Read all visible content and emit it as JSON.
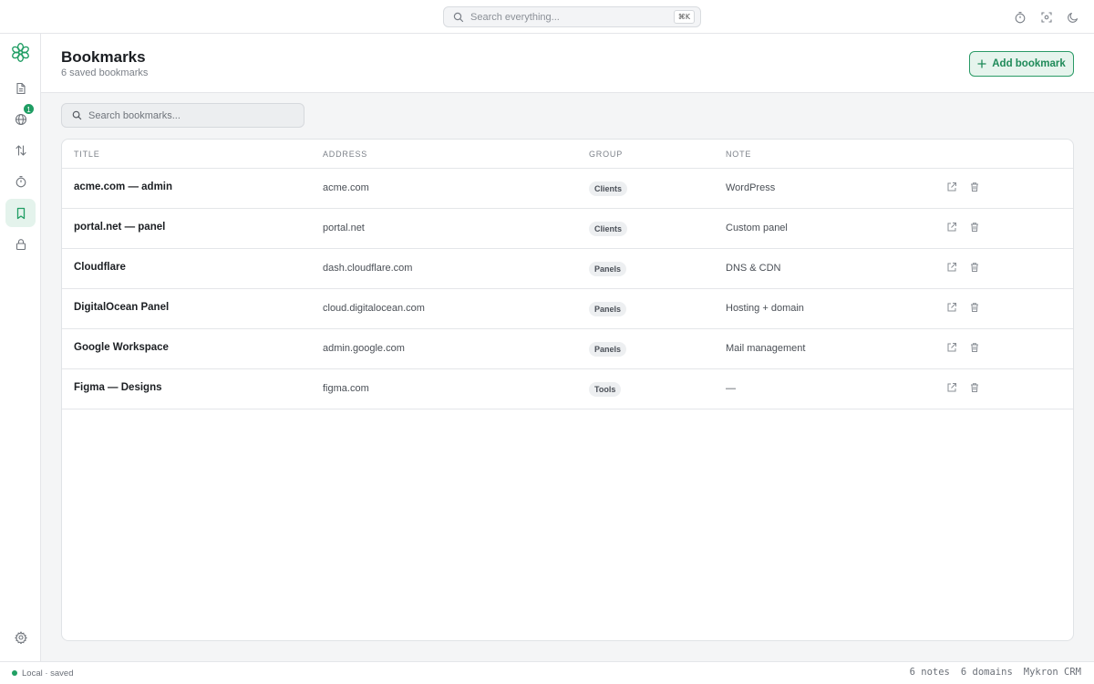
{
  "topbar": {
    "search_placeholder": "Search everything...",
    "search_shortcut": "⌘K",
    "actions": [
      "timer-icon",
      "scan-icon",
      "moon-icon"
    ]
  },
  "sidebar": {
    "logo": "flower-logo-icon",
    "items": [
      {
        "icon": "document-icon",
        "active": false
      },
      {
        "icon": "globe-icon",
        "active": false,
        "badge": "1"
      },
      {
        "icon": "transfer-arrows-icon",
        "active": false
      },
      {
        "icon": "stopwatch-icon",
        "active": false
      },
      {
        "icon": "bookmark-icon",
        "active": true
      },
      {
        "icon": "lock-icon",
        "active": false
      }
    ],
    "settings_icon": "gear-icon"
  },
  "header": {
    "title": "Bookmarks",
    "subtitle": "6 saved bookmarks",
    "add_button": "Add bookmark"
  },
  "search": {
    "placeholder": "Search bookmarks..."
  },
  "table": {
    "columns": [
      "TITLE",
      "ADDRESS",
      "GROUP",
      "NOTE"
    ],
    "rows": [
      {
        "title": "acme.com — admin",
        "address": "acme.com",
        "group": "Clients",
        "note": "WordPress"
      },
      {
        "title": "portal.net — panel",
        "address": "portal.net",
        "group": "Clients",
        "note": "Custom panel"
      },
      {
        "title": "Cloudflare",
        "address": "dash.cloudflare.com",
        "group": "Panels",
        "note": "DNS & CDN"
      },
      {
        "title": "DigitalOcean Panel",
        "address": "cloud.digitalocean.com",
        "group": "Panels",
        "note": "Hosting + domain"
      },
      {
        "title": "Google Workspace",
        "address": "admin.google.com",
        "group": "Panels",
        "note": "Mail management"
      },
      {
        "title": "Figma — Designs",
        "address": "figma.com",
        "group": "Tools",
        "note": "—"
      }
    ]
  },
  "statusbar": {
    "state": "Local · saved",
    "notes": "6 notes",
    "domains": "6 domains",
    "app": "Mykron CRM"
  },
  "colors": {
    "accent": "#1f9d63",
    "accent_bg": "#e6f4ed"
  }
}
